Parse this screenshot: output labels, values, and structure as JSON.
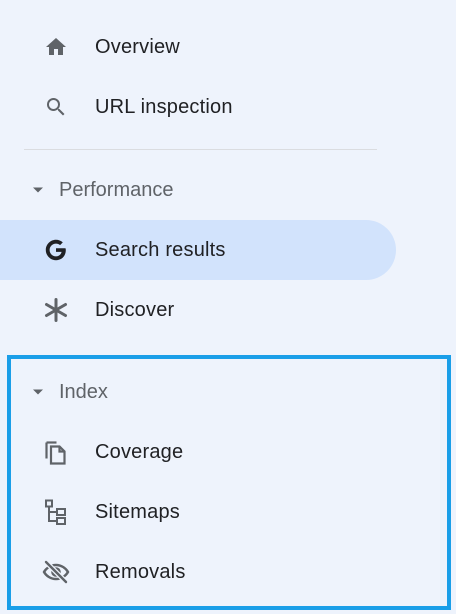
{
  "nav": {
    "overview": {
      "label": "Overview",
      "icon": "home-icon"
    },
    "url_inspection": {
      "label": "URL inspection",
      "icon": "search-icon"
    }
  },
  "performance": {
    "header": "Performance",
    "items": [
      {
        "label": "Search results",
        "icon": "google-g-icon",
        "selected": true
      },
      {
        "label": "Discover",
        "icon": "asterisk-icon",
        "selected": false
      }
    ]
  },
  "index": {
    "header": "Index",
    "items": [
      {
        "label": "Coverage",
        "icon": "copy-pages-icon"
      },
      {
        "label": "Sitemaps",
        "icon": "sitemap-icon"
      },
      {
        "label": "Removals",
        "icon": "visibility-off-icon"
      }
    ]
  },
  "colors": {
    "background": "#eef3fc",
    "selected": "#d2e3fc",
    "highlight_border": "#1a9ee8",
    "icon": "#5f6368",
    "text": "#202124"
  }
}
